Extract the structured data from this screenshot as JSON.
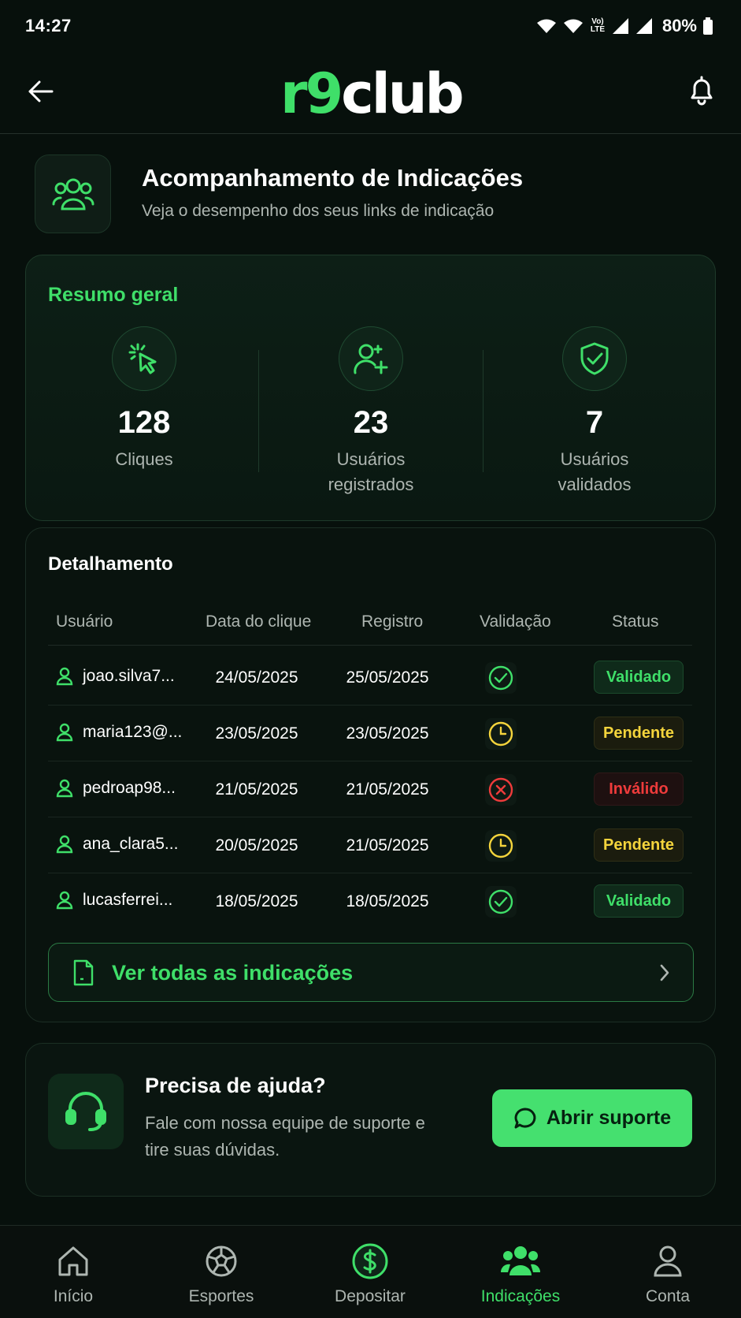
{
  "status_bar": {
    "time": "14:27",
    "volte": "Vo) LTE",
    "battery": "80%"
  },
  "app": {
    "logo_green": "r9",
    "logo_white": "club"
  },
  "header": {
    "title": "Acompanhamento de Indicações",
    "subtitle": "Veja o desempenho dos seus links de indicação"
  },
  "summary": {
    "label": "Resumo geral",
    "stats": [
      {
        "value": "128",
        "caption": "Cliques",
        "icon": "cursor-click-icon"
      },
      {
        "value": "23",
        "caption": "Usuários registrados",
        "icon": "user-plus-icon"
      },
      {
        "value": "7",
        "caption": "Usuários validados",
        "icon": "shield-check-icon"
      }
    ]
  },
  "details": {
    "label": "Detalhamento",
    "columns": [
      "Usuário",
      "Data do clique",
      "Registro",
      "Validação",
      "Status"
    ],
    "rows": [
      {
        "user": "joao.silva7...",
        "click": "24/05/2025",
        "reg": "25/05/2025",
        "validation": "check",
        "status": "Validado"
      },
      {
        "user": "maria123@...",
        "click": "23/05/2025",
        "reg": "23/05/2025",
        "validation": "clock",
        "status": "Pendente"
      },
      {
        "user": "pedroap98...",
        "click": "21/05/2025",
        "reg": "21/05/2025",
        "validation": "x",
        "status": "Inválido"
      },
      {
        "user": "ana_clara5...",
        "click": "20/05/2025",
        "reg": "21/05/2025",
        "validation": "clock",
        "status": "Pendente"
      },
      {
        "user": "lucasferrei...",
        "click": "18/05/2025",
        "reg": "18/05/2025",
        "validation": "check",
        "status": "Validado"
      }
    ],
    "view_all": "Ver todas as indicações"
  },
  "help": {
    "title": "Precisa de ajuda?",
    "desc": "Fale com nossa equipe de suporte e tire suas dúvidas.",
    "button": "Abrir suporte"
  },
  "nav": [
    {
      "label": "Início",
      "icon": "home-icon"
    },
    {
      "label": "Esportes",
      "icon": "soccer-ball-icon"
    },
    {
      "label": "Depositar",
      "icon": "dollar-circle-icon"
    },
    {
      "label": "Indicações",
      "icon": "users-icon",
      "active": true
    },
    {
      "label": "Conta",
      "icon": "user-icon"
    }
  ],
  "colors": {
    "accent": "#3fdf69",
    "pending": "#f4d43c",
    "invalid": "#ee3b3b",
    "background": "#07100c"
  }
}
